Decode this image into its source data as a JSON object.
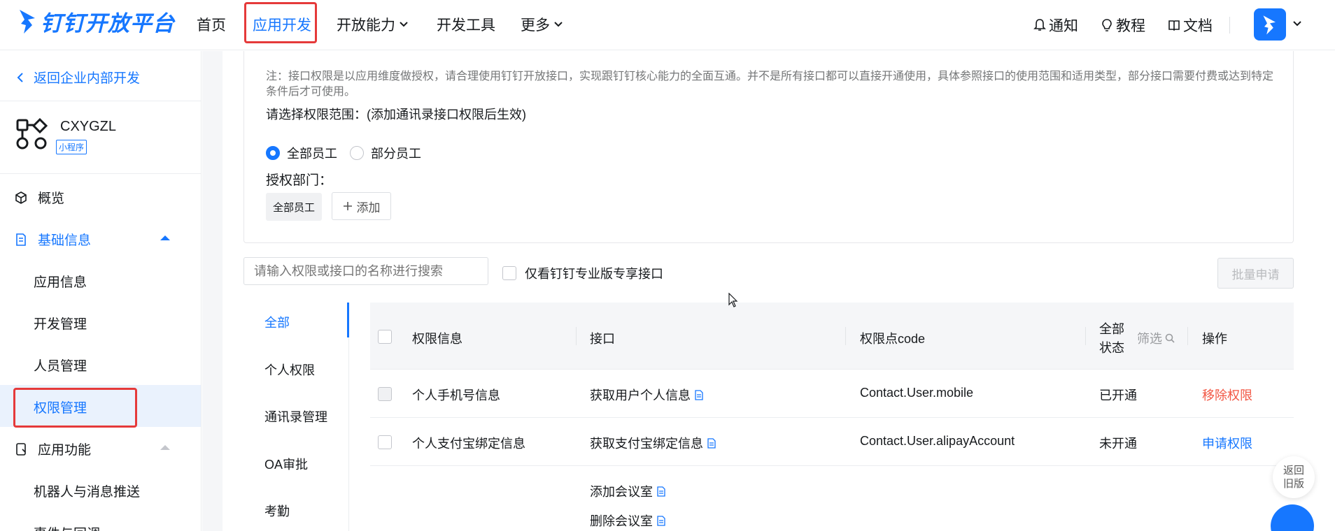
{
  "brand": {
    "name": "钉钉开放平台",
    "color": "#1677ff"
  },
  "nav": {
    "items": [
      {
        "label": "首页"
      },
      {
        "label": "应用开发"
      },
      {
        "label": "开放能力"
      },
      {
        "label": "开发工具"
      },
      {
        "label": "更多"
      }
    ],
    "right": {
      "notify": "通知",
      "tutorial": "教程",
      "docs": "文档"
    }
  },
  "sidebar": {
    "back": "返回企业内部开发",
    "app": {
      "name": "CXYGZL",
      "tag": "小程序"
    },
    "menu": {
      "overview": "概览",
      "basic_info": "基础信息",
      "app_info": "应用信息",
      "dev_manage": "开发管理",
      "people_manage": "人员管理",
      "perm_manage": "权限管理",
      "app_features": "应用功能",
      "robot_push": "机器人与消息推送",
      "events_callback": "事件与回调"
    }
  },
  "scope": {
    "note": "注：接口权限是以应用维度做授权，请合理使用钉钉开放接口，实现跟钉钉核心能力的全面互通。并不是所有接口都可以直接开通使用，具体参照接口的使用范围和适用类型，部分接口需要付费或达到特定条件后才可使用。",
    "label": "请选择权限范围：(添加通讯录接口权限后生效)",
    "radio_all": "全部员工",
    "radio_part": "部分员工",
    "dept_label": "授权部门：",
    "dept_chip": "全部员工",
    "add_label": "添加"
  },
  "filters": {
    "search_placeholder": "请输入权限或接口的名称进行搜索",
    "only_pro": "仅看钉钉专业版专享接口",
    "batch": "批量申请"
  },
  "categories": [
    "全部",
    "个人权限",
    "通讯录管理",
    "OA审批",
    "考勤"
  ],
  "table": {
    "headers": {
      "perm": "权限信息",
      "api": "接口",
      "code": "权限点code",
      "status_all": "全部",
      "status": "状态",
      "filter": "筛选",
      "action": "操作"
    },
    "rows": [
      {
        "perm": "个人手机号信息",
        "api": "获取用户个人信息",
        "code": "Contact.User.mobile",
        "status": "已开通",
        "action": "移除权限"
      },
      {
        "perm": "个人支付宝绑定信息",
        "api": "获取支付宝绑定信息",
        "code": "Contact.User.alipayAccount",
        "status": "未开通",
        "action": "申请权限"
      },
      {
        "perm": "",
        "api": "添加会议室",
        "api2": "删除会议室",
        "code": "",
        "status": "",
        "action": ""
      }
    ]
  },
  "float": {
    "old_line1": "返回",
    "old_line2": "旧版"
  }
}
